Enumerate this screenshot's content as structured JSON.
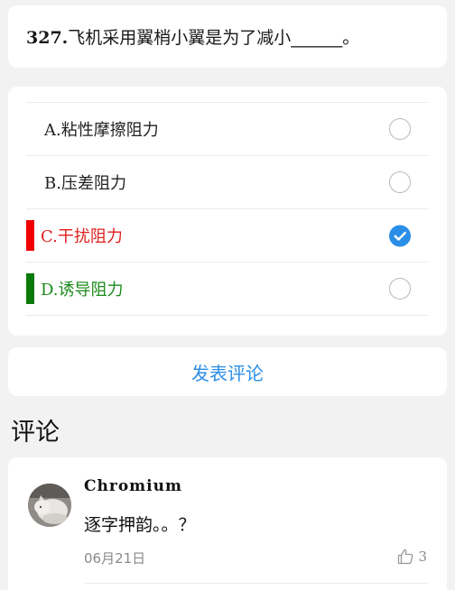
{
  "question": {
    "number": "327.",
    "text": "飞机采用翼梢小翼是为了减小______。"
  },
  "options": [
    {
      "letter": "A.",
      "text": "粘性摩擦阻力",
      "color": "#222222",
      "marker": "",
      "selected": false
    },
    {
      "letter": "B.",
      "text": "压差阻力",
      "color": "#222222",
      "marker": "",
      "selected": false
    },
    {
      "letter": "C.",
      "text": "干扰阻力",
      "color": "#e02020",
      "marker": "#f00000",
      "selected": true
    },
    {
      "letter": "D.",
      "text": "诱导阻力",
      "color": "#1a8a1a",
      "marker": "#0a7a0a",
      "selected": false
    }
  ],
  "accent_color": "#2b8ee6",
  "post_comment_label": "发表评论",
  "comments_title": "评论",
  "comments": [
    {
      "user": "Chromium",
      "text": "逐字押韵。。？",
      "date": "06月21日",
      "likes": "3",
      "avatar": "cat-photo-avatar"
    }
  ]
}
